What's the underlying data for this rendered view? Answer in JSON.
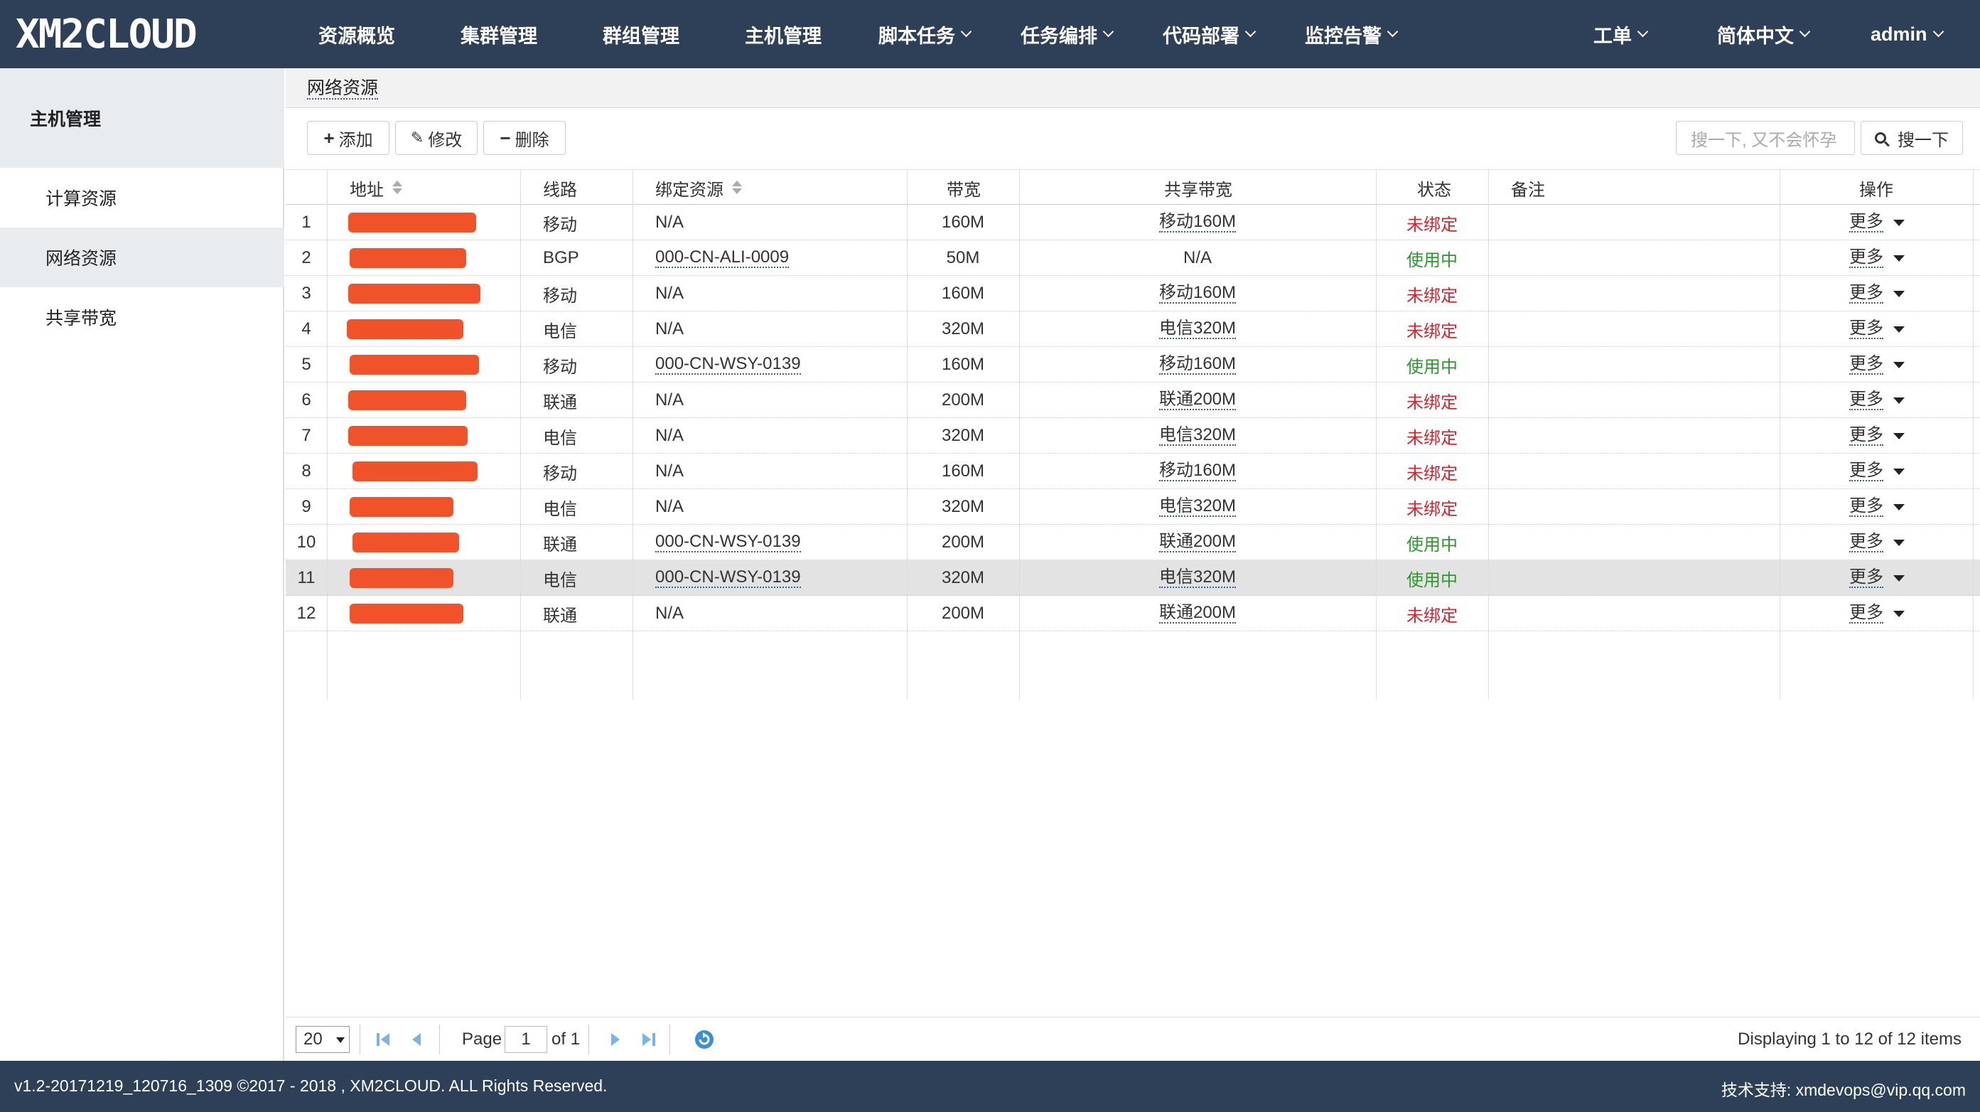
{
  "app": {
    "logo": "XM2CLOUD",
    "nav": [
      {
        "label": "资源概览",
        "dropdown": false
      },
      {
        "label": "集群管理",
        "dropdown": false
      },
      {
        "label": "群组管理",
        "dropdown": false
      },
      {
        "label": "主机管理",
        "dropdown": false
      },
      {
        "label": "脚本任务",
        "dropdown": true
      },
      {
        "label": "任务编排",
        "dropdown": true
      },
      {
        "label": "代码部署",
        "dropdown": true
      },
      {
        "label": "监控告警",
        "dropdown": true
      }
    ],
    "right_nav": [
      {
        "label": "工单",
        "dropdown": true
      },
      {
        "label": "简体中文",
        "dropdown": true
      },
      {
        "label": "admin",
        "dropdown": true
      }
    ]
  },
  "sidebar": {
    "title": "主机管理",
    "items": [
      {
        "label": "计算资源",
        "active": false
      },
      {
        "label": "网络资源",
        "active": true
      },
      {
        "label": "共享带宽",
        "active": false
      }
    ]
  },
  "main": {
    "panel_title": "网络资源",
    "toolbar": {
      "add_label": "添加",
      "edit_label": "修改",
      "delete_label": "删除",
      "search_placeholder": "搜一下, 又不会怀孕",
      "search_label": "搜一下"
    },
    "table": {
      "headers": {
        "address": "地址",
        "line": "线路",
        "bound": "绑定资源",
        "bandwidth": "带宽",
        "shared": "共享带宽",
        "status": "状态",
        "remark": "备注",
        "ops": "操作"
      },
      "more_label": "更多",
      "rows": [
        {
          "num": "1",
          "line": "移动",
          "bound": "N/A",
          "bw": "160M",
          "shared": "移动160M",
          "status": "未绑定"
        },
        {
          "num": "2",
          "line": "BGP",
          "bound": "000-CN-ALI-0009",
          "bw": "50M",
          "shared": "N/A",
          "status": "使用中"
        },
        {
          "num": "3",
          "line": "移动",
          "bound": "N/A",
          "bw": "160M",
          "shared": "移动160M",
          "status": "未绑定"
        },
        {
          "num": "4",
          "line": "电信",
          "bound": "N/A",
          "bw": "320M",
          "shared": "电信320M",
          "status": "未绑定"
        },
        {
          "num": "5",
          "line": "移动",
          "bound": "000-CN-WSY-0139",
          "bw": "160M",
          "shared": "移动160M",
          "status": "使用中"
        },
        {
          "num": "6",
          "line": "联通",
          "bound": "N/A",
          "bw": "200M",
          "shared": "联通200M",
          "status": "未绑定"
        },
        {
          "num": "7",
          "line": "电信",
          "bound": "N/A",
          "bw": "320M",
          "shared": "电信320M",
          "status": "未绑定"
        },
        {
          "num": "8",
          "line": "移动",
          "bound": "N/A",
          "bw": "160M",
          "shared": "移动160M",
          "status": "未绑定"
        },
        {
          "num": "9",
          "line": "电信",
          "bound": "N/A",
          "bw": "320M",
          "shared": "电信320M",
          "status": "未绑定"
        },
        {
          "num": "10",
          "line": "联通",
          "bound": "000-CN-WSY-0139",
          "bw": "200M",
          "shared": "联通200M",
          "status": "使用中"
        },
        {
          "num": "11",
          "line": "电信",
          "bound": "000-CN-WSY-0139",
          "bw": "320M",
          "shared": "电信320M",
          "status": "使用中"
        },
        {
          "num": "12",
          "line": "联通",
          "bound": "N/A",
          "bw": "200M",
          "shared": "联通200M",
          "status": "未绑定"
        }
      ]
    },
    "pager": {
      "page_size": "20",
      "page_label": "Page",
      "page_value": "1",
      "of_label": "of 1",
      "display_text": "Displaying 1 to 12 of 12 items"
    }
  },
  "footer": {
    "left": "v1.2-20171219_120716_1309 ©2017 - 2018 , XM2CLOUD. ALL Rights Reserved.",
    "right": "技术支持: xmdevops@vip.qq.com"
  },
  "colors": {
    "nav_bg": "#2e4057",
    "status_unbound": "#d9232d",
    "status_inuse": "#2a9a2a",
    "redaction": "#f0532a",
    "link_underline": "#3a5f9f"
  }
}
